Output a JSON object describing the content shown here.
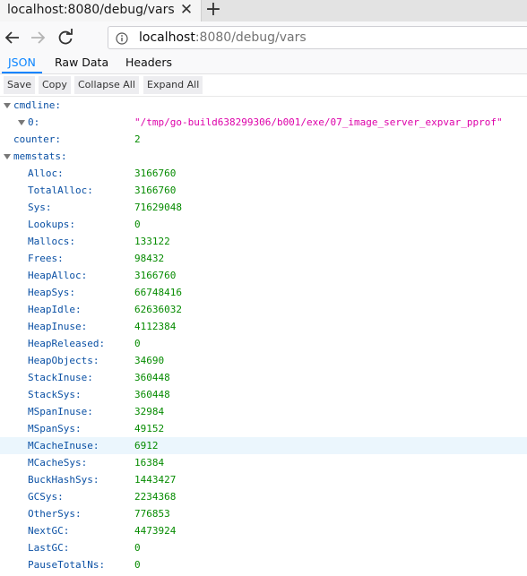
{
  "browser": {
    "tab_title": "localhost:8080/debug/vars",
    "url_host": "localhost",
    "url_rest": ":8080/debug/vars"
  },
  "viewer": {
    "tabs": [
      "JSON",
      "Raw Data",
      "Headers"
    ],
    "toolbar": [
      "Save",
      "Copy",
      "Collapse All",
      "Expand All"
    ]
  },
  "json": {
    "cmdline_key": "cmdline:",
    "cmdline_item_key": "0:",
    "cmdline_item_value": "\"/tmp/go-build638299306/b001/exe/07_image_server_expvar_pprof\"",
    "counter_key": "counter:",
    "counter_value": "2",
    "memstats_key": "memstats:",
    "memstats": [
      {
        "key": "Alloc:",
        "value": "3166760"
      },
      {
        "key": "TotalAlloc:",
        "value": "3166760"
      },
      {
        "key": "Sys:",
        "value": "71629048"
      },
      {
        "key": "Lookups:",
        "value": "0"
      },
      {
        "key": "Mallocs:",
        "value": "133122"
      },
      {
        "key": "Frees:",
        "value": "98432"
      },
      {
        "key": "HeapAlloc:",
        "value": "3166760"
      },
      {
        "key": "HeapSys:",
        "value": "66748416"
      },
      {
        "key": "HeapIdle:",
        "value": "62636032"
      },
      {
        "key": "HeapInuse:",
        "value": "4112384"
      },
      {
        "key": "HeapReleased:",
        "value": "0"
      },
      {
        "key": "HeapObjects:",
        "value": "34690"
      },
      {
        "key": "StackInuse:",
        "value": "360448"
      },
      {
        "key": "StackSys:",
        "value": "360448"
      },
      {
        "key": "MSpanInuse:",
        "value": "32984"
      },
      {
        "key": "MSpanSys:",
        "value": "49152"
      },
      {
        "key": "MCacheInuse:",
        "value": "6912"
      },
      {
        "key": "MCacheSys:",
        "value": "16384"
      },
      {
        "key": "BuckHashSys:",
        "value": "1443427"
      },
      {
        "key": "GCSys:",
        "value": "2234368"
      },
      {
        "key": "OtherSys:",
        "value": "776853"
      },
      {
        "key": "NextGC:",
        "value": "4473924"
      },
      {
        "key": "LastGC:",
        "value": "0"
      },
      {
        "key": "PauseTotalNs:",
        "value": "0"
      }
    ],
    "highlighted_key": "MCacheInuse:"
  },
  "colors": {
    "key": "#0a50a4",
    "number": "#058b00",
    "string": "#dd00a9",
    "active_tab": "#0a84ff",
    "row_highlight": "#ebf6fd"
  }
}
